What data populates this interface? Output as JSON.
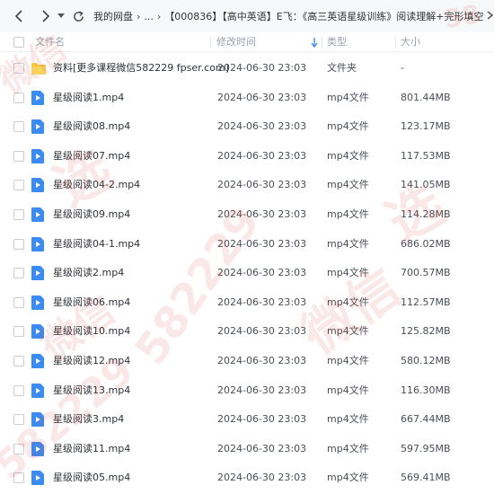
{
  "toolbar": {
    "back_icon": "chevron-left-icon",
    "forward_icon": "chevron-right-icon",
    "dropdown_icon": "caret-down-icon",
    "refresh_icon": "refresh-icon",
    "breadcrumb": [
      "我的网盘",
      "...",
      "【000836】【高中英语】E飞：《高三英语星级训练》阅读理解+完形填空"
    ],
    "breadcrumb_separator": "›",
    "breadcrumb_end_icon": "chevron-right-icon"
  },
  "columns": {
    "name": "文件名",
    "modified": "修改时间",
    "type": "类型",
    "size": "大小",
    "sort_icon": "arrow-down-icon"
  },
  "rows": [
    {
      "name": "资料[更多课程微信582229 fpser.com]",
      "date": "2024-06-30 23:03",
      "type": "文件夹",
      "size": "-",
      "icon": "folder-icon"
    },
    {
      "name": "星级阅读1.mp4",
      "date": "2024-06-30 23:03",
      "type": "mp4文件",
      "size": "801.44MB",
      "icon": "video-file-icon"
    },
    {
      "name": "星级阅读08.mp4",
      "date": "2024-06-30 23:03",
      "type": "mp4文件",
      "size": "123.17MB",
      "icon": "video-file-icon"
    },
    {
      "name": "星级阅读07.mp4",
      "date": "2024-06-30 23:03",
      "type": "mp4文件",
      "size": "117.53MB",
      "icon": "video-file-icon"
    },
    {
      "name": "星级阅读04-2.mp4",
      "date": "2024-06-30 23:03",
      "type": "mp4文件",
      "size": "141.05MB",
      "icon": "video-file-icon"
    },
    {
      "name": "星级阅读09.mp4",
      "date": "2024-06-30 23:03",
      "type": "mp4文件",
      "size": "114.28MB",
      "icon": "video-file-icon"
    },
    {
      "name": "星级阅读04-1.mp4",
      "date": "2024-06-30 23:03",
      "type": "mp4文件",
      "size": "686.02MB",
      "icon": "video-file-icon"
    },
    {
      "name": "星级阅读2.mp4",
      "date": "2024-06-30 23:03",
      "type": "mp4文件",
      "size": "700.57MB",
      "icon": "video-file-icon"
    },
    {
      "name": "星级阅读06.mp4",
      "date": "2024-06-30 23:03",
      "type": "mp4文件",
      "size": "112.57MB",
      "icon": "video-file-icon"
    },
    {
      "name": "星级阅读10.mp4",
      "date": "2024-06-30 23:03",
      "type": "mp4文件",
      "size": "125.82MB",
      "icon": "video-file-icon"
    },
    {
      "name": "星级阅读12.mp4",
      "date": "2024-06-30 23:03",
      "type": "mp4文件",
      "size": "580.12MB",
      "icon": "video-file-icon"
    },
    {
      "name": "星级阅读13.mp4",
      "date": "2024-06-30 23:03",
      "type": "mp4文件",
      "size": "116.30MB",
      "icon": "video-file-icon"
    },
    {
      "name": "星级阅读3.mp4",
      "date": "2024-06-30 23:03",
      "type": "mp4文件",
      "size": "667.44MB",
      "icon": "video-file-icon"
    },
    {
      "name": "星级阅读11.mp4",
      "date": "2024-06-30 23:03",
      "type": "mp4文件",
      "size": "597.95MB",
      "icon": "video-file-icon"
    },
    {
      "name": "星级阅读05.mp4",
      "date": "2024-06-30 23:03",
      "type": "mp4文件",
      "size": "569.41MB",
      "icon": "video-file-icon"
    }
  ],
  "watermarks": [
    "微信",
    "582229",
    "选",
    "微信",
    "582229",
    "选",
    "微信",
    "58"
  ],
  "colors": {
    "folder": "#f5c542",
    "video_icon": "#3b8bf5",
    "watermark": "#d64646"
  }
}
